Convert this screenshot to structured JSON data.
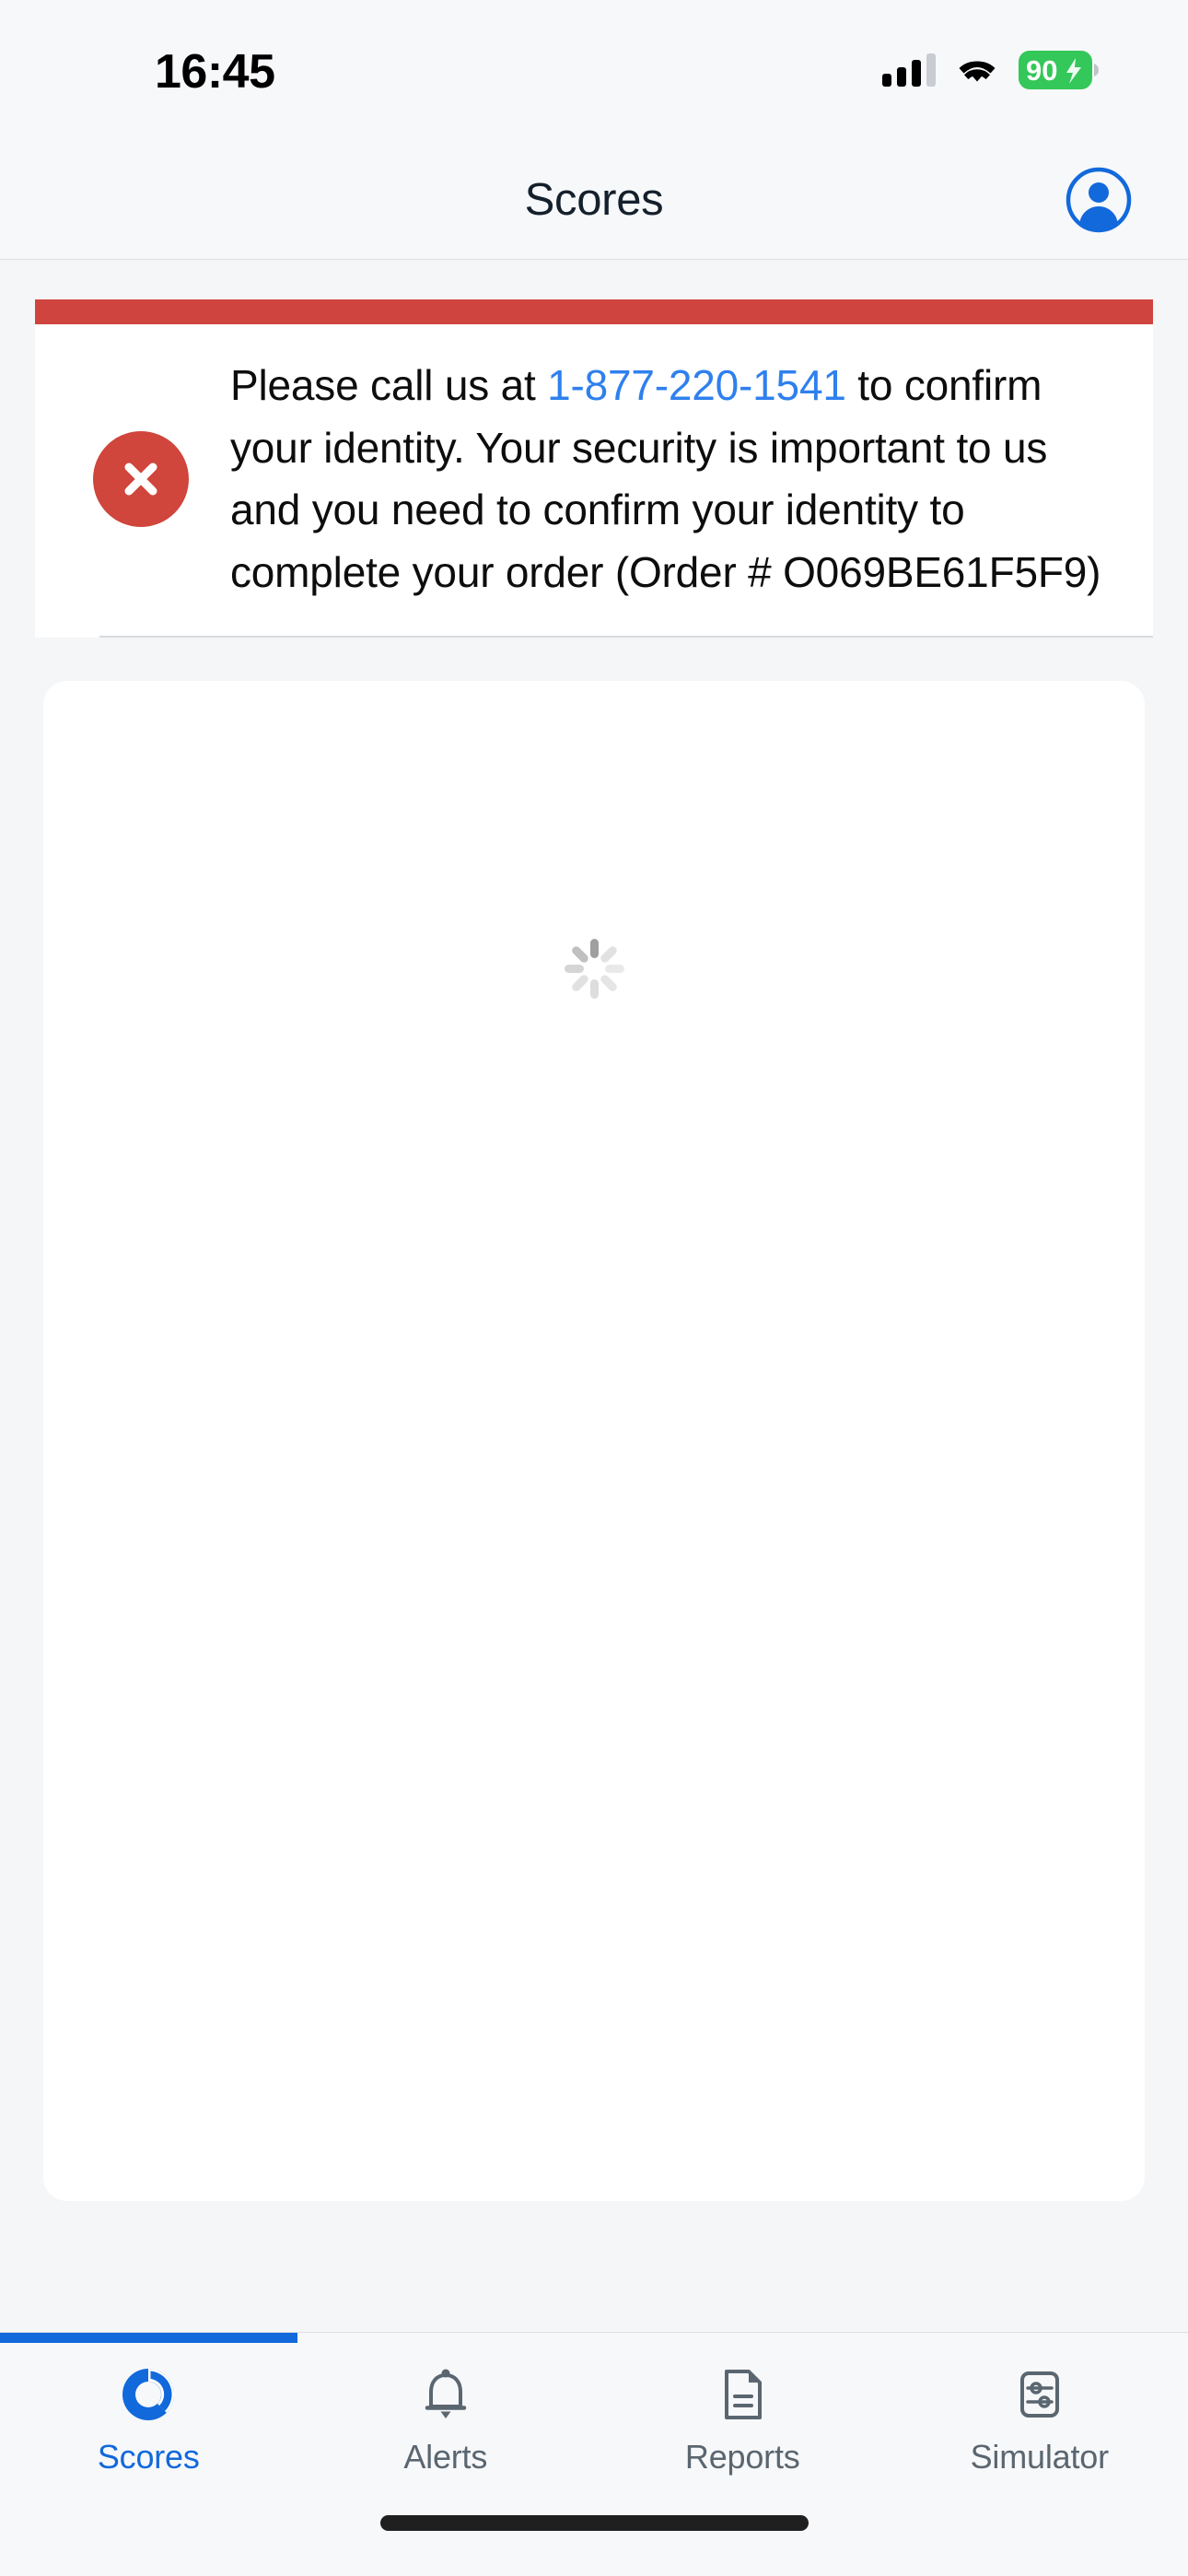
{
  "status_bar": {
    "time": "16:45",
    "cellular_icon": "cellular-signal-icon",
    "cellular_bars_filled": 3,
    "cellular_bars_total": 4,
    "wifi_icon": "wifi-icon",
    "battery_level": "90",
    "battery_charging": true,
    "battery_color": "#34c759"
  },
  "header": {
    "title": "Scores",
    "account_icon": "account-circle-icon"
  },
  "error_banner": {
    "icon": "error-circle-x-icon",
    "accent_color": "#d04440",
    "text_before": "Please call us at ",
    "phone": "1-877-220-1541",
    "phone_color": "#2f80ed",
    "text_after": " to confirm your identity. Your security is important to us and you need to confirm your identity to complete your order (Order # O069BE61F5F9)",
    "order_number": "O069BE61F5F9"
  },
  "main": {
    "loading_spinner": "loading-spinner-icon",
    "state": "loading"
  },
  "progress": {
    "percent": 25,
    "color": "#1269db"
  },
  "tab_bar": {
    "active_index": 0,
    "active_color": "#1269db",
    "inactive_color": "#5a6670",
    "items": [
      {
        "label": "Scores",
        "icon": "gauge-score-icon"
      },
      {
        "label": "Alerts",
        "icon": "bell-icon"
      },
      {
        "label": "Reports",
        "icon": "document-icon"
      },
      {
        "label": "Simulator",
        "icon": "sliders-icon"
      }
    ]
  },
  "home_indicator": {
    "name": "home-indicator"
  }
}
